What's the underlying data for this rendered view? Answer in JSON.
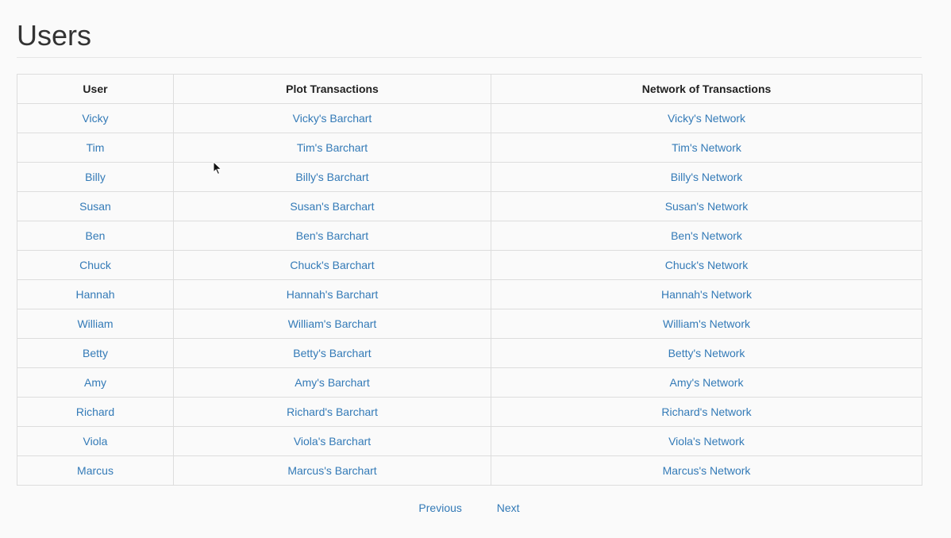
{
  "page": {
    "title": "Users"
  },
  "table": {
    "headers": [
      "User",
      "Plot Transactions",
      "Network of Transactions"
    ],
    "rows": [
      {
        "user": "Vicky",
        "barchart": "Vicky's Barchart",
        "network": "Vicky's Network"
      },
      {
        "user": "Tim",
        "barchart": "Tim's Barchart",
        "network": "Tim's Network"
      },
      {
        "user": "Billy",
        "barchart": "Billy's Barchart",
        "network": "Billy's Network"
      },
      {
        "user": "Susan",
        "barchart": "Susan's Barchart",
        "network": "Susan's Network"
      },
      {
        "user": "Ben",
        "barchart": "Ben's Barchart",
        "network": "Ben's Network"
      },
      {
        "user": "Chuck",
        "barchart": "Chuck's Barchart",
        "network": "Chuck's Network"
      },
      {
        "user": "Hannah",
        "barchart": "Hannah's Barchart",
        "network": "Hannah's Network"
      },
      {
        "user": "William",
        "barchart": "William's Barchart",
        "network": "William's Network"
      },
      {
        "user": "Betty",
        "barchart": "Betty's Barchart",
        "network": "Betty's Network"
      },
      {
        "user": "Amy",
        "barchart": "Amy's Barchart",
        "network": "Amy's Network"
      },
      {
        "user": "Richard",
        "barchart": "Richard's Barchart",
        "network": "Richard's Network"
      },
      {
        "user": "Viola",
        "barchart": "Viola's Barchart",
        "network": "Viola's Network"
      },
      {
        "user": "Marcus",
        "barchart": "Marcus's Barchart",
        "network": "Marcus's Network"
      }
    ]
  },
  "pager": {
    "previous_label": "Previous",
    "next_label": "Next"
  },
  "colors": {
    "link": "#337ab7",
    "background": "#fafafa",
    "border": "#dddddd"
  },
  "icons": {
    "cursor": "mouse-pointer-icon"
  }
}
